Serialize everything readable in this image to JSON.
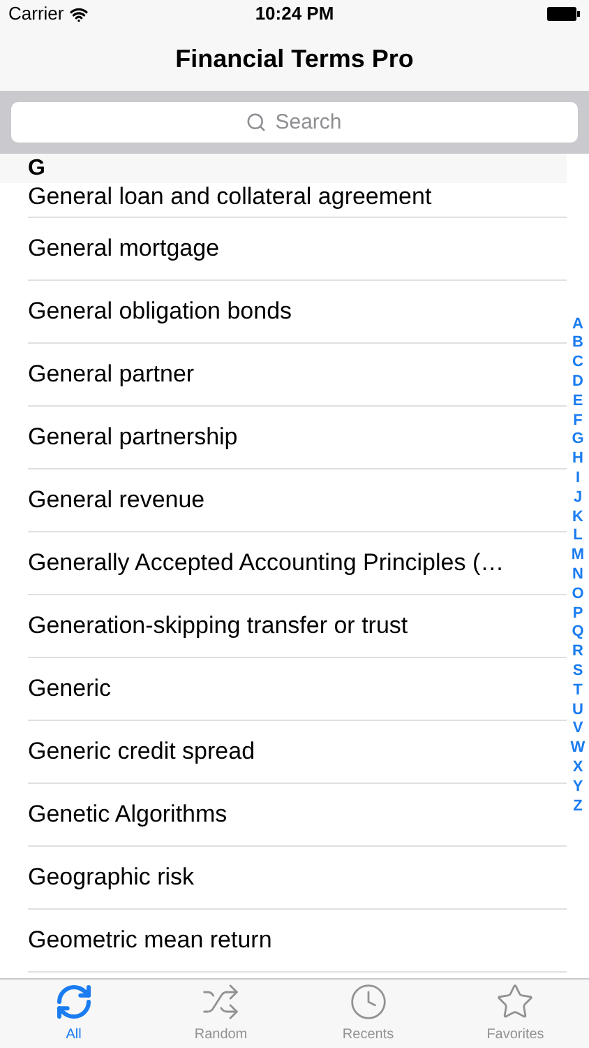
{
  "status_bar": {
    "carrier": "Carrier",
    "time": "10:24 PM"
  },
  "nav": {
    "title": "Financial Terms Pro"
  },
  "search": {
    "placeholder": "Search"
  },
  "section": {
    "header": "G",
    "rows": [
      "General loan and collateral agreement",
      "General mortgage",
      "General obligation bonds",
      "General partner",
      "General partnership",
      "General revenue",
      "Generally Accepted Accounting Principles (…",
      "Generation-skipping transfer or trust",
      "Generic",
      "Generic credit spread",
      "Genetic Algorithms",
      "Geographic risk",
      "Geometric mean return"
    ]
  },
  "index": [
    "A",
    "B",
    "C",
    "D",
    "E",
    "F",
    "G",
    "H",
    "I",
    "J",
    "K",
    "L",
    "M",
    "N",
    "O",
    "P",
    "Q",
    "R",
    "S",
    "T",
    "U",
    "V",
    "W",
    "X",
    "Y",
    "Z"
  ],
  "tabs": [
    {
      "label": "All",
      "selected": true
    },
    {
      "label": "Random",
      "selected": false
    },
    {
      "label": "Recents",
      "selected": false
    },
    {
      "label": "Favorites",
      "selected": false
    }
  ]
}
